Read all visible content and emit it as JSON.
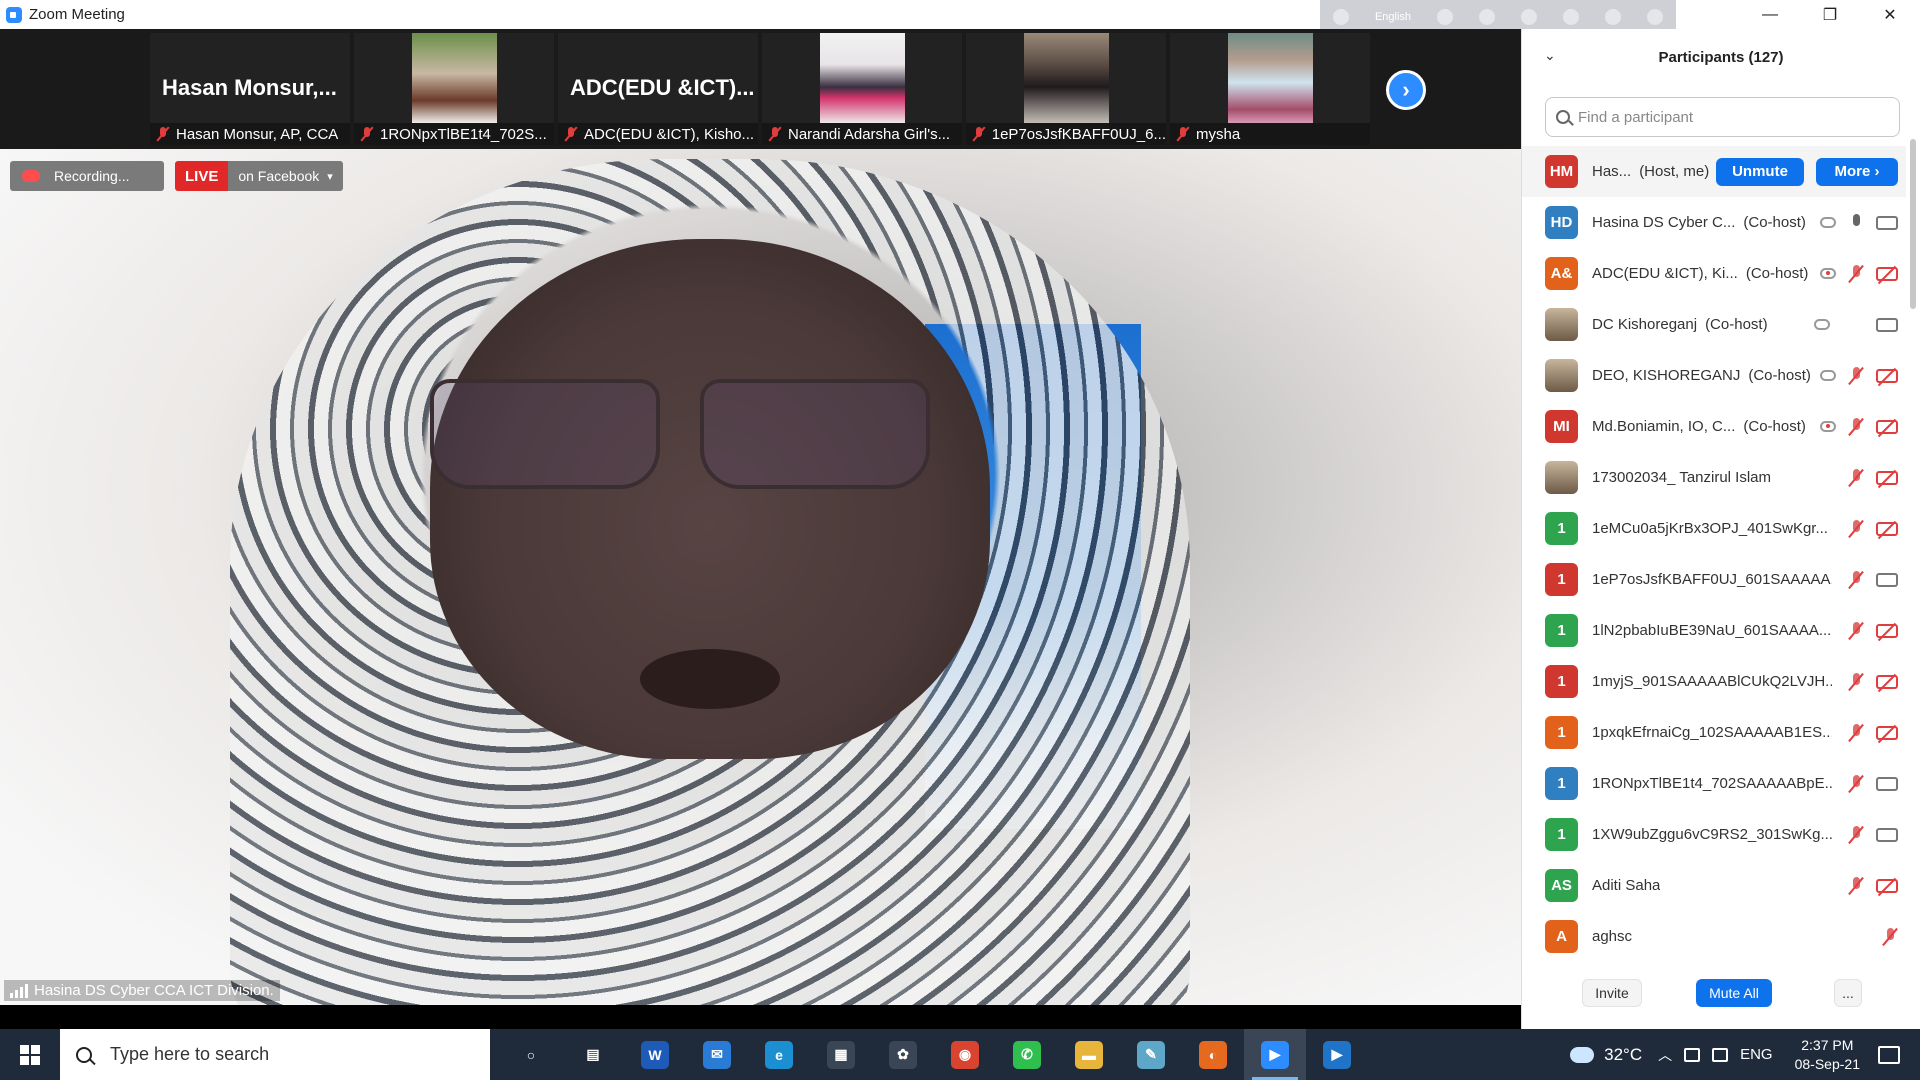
{
  "window": {
    "title": "Zoom Meeting",
    "minimize": "—",
    "maximize": "❐",
    "close": "✕"
  },
  "float_toolbar": {
    "language": "English"
  },
  "strip": {
    "thumbs": [
      {
        "big_name": "Hasan  Monsur,...",
        "caption": "Hasan Monsur, AP, CCA"
      },
      {
        "big_name": "",
        "caption": "1RONpxTlBE1t4_702S..."
      },
      {
        "big_name": "ADC(EDU  &ICT)...",
        "caption": "ADC(EDU &ICT), Kisho..."
      },
      {
        "big_name": "",
        "caption": "Narandi Adarsha Girl's..."
      },
      {
        "big_name": "",
        "caption": "1eP7osJsfKBAFF0UJ_6..."
      },
      {
        "big_name": "",
        "caption": "mysha"
      }
    ],
    "next_icon": "›"
  },
  "main": {
    "recording_label": "Recording...",
    "live_label": "LIVE",
    "live_target": "on Facebook",
    "speaker_name": "Hasina DS Cyber CCA ICT Division."
  },
  "panel": {
    "title": "Participants (127)",
    "collapse_icon": "⌄",
    "search_placeholder": "Find a participant",
    "host": {
      "avatar": "HM",
      "name": "Has...",
      "role": "(Host, me)",
      "unmute": "Unmute",
      "more": "More ›"
    },
    "participants": [
      {
        "avatar": "HD",
        "color": "#2f7fc1",
        "name": "Hasina DS Cyber C...",
        "role": "(Co-host)",
        "rec": "gray",
        "mic": "on",
        "cam": "on"
      },
      {
        "avatar": "A&",
        "color": "#e2611b",
        "name": "ADC(EDU &ICT), Ki...",
        "role": "(Co-host)",
        "rec": "red",
        "mic": "off",
        "cam": "off"
      },
      {
        "avatar": "",
        "color": "photo",
        "name": "DC Kishoreganj",
        "role": "(Co-host)",
        "rec": "gray",
        "mic": "none",
        "cam": "on"
      },
      {
        "avatar": "",
        "color": "photo",
        "name": "DEO, KISHOREGANJ",
        "role": "(Co-host)",
        "rec": "gray",
        "mic": "off",
        "cam": "off"
      },
      {
        "avatar": "MI",
        "color": "#d0372f",
        "name": "Md.Boniamin, IO, C...",
        "role": "(Co-host)",
        "rec": "red",
        "mic": "off",
        "cam": "off"
      },
      {
        "avatar": "",
        "color": "photo",
        "name": "173002034_ Tanzirul Islam",
        "role": "",
        "rec": "none",
        "mic": "off",
        "cam": "off"
      },
      {
        "avatar": "1",
        "color": "#2ea44f",
        "name": "1eMCu0a5jKrBx3OPJ_401SwKgr...",
        "role": "",
        "rec": "none",
        "mic": "off",
        "cam": "off"
      },
      {
        "avatar": "1",
        "color": "#d0372f",
        "name": "1eP7osJsfKBAFF0UJ_601SAAAAA...",
        "role": "",
        "rec": "none",
        "mic": "off",
        "cam": "on"
      },
      {
        "avatar": "1",
        "color": "#2ea44f",
        "name": "1lN2pbabIuBE39NaU_601SAAAA...",
        "role": "",
        "rec": "none",
        "mic": "off",
        "cam": "off"
      },
      {
        "avatar": "1",
        "color": "#d0372f",
        "name": "1myjS_901SAAAAABlCUkQ2LVJH...",
        "role": "",
        "rec": "none",
        "mic": "off",
        "cam": "off"
      },
      {
        "avatar": "1",
        "color": "#e2611b",
        "name": "1pxqkEfrnaiCg_102SAAAAAB1ES...",
        "role": "",
        "rec": "none",
        "mic": "off",
        "cam": "off"
      },
      {
        "avatar": "1",
        "color": "#2f7fc1",
        "name": "1RONpxTlBE1t4_702SAAAAABpE...",
        "role": "",
        "rec": "none",
        "mic": "off",
        "cam": "on"
      },
      {
        "avatar": "1",
        "color": "#2ea44f",
        "name": "1XW9ubZggu6vC9RS2_301SwKg...",
        "role": "",
        "rec": "none",
        "mic": "off",
        "cam": "on"
      },
      {
        "avatar": "AS",
        "color": "#2ea44f",
        "name": "Aditi Saha",
        "role": "",
        "rec": "none",
        "mic": "off",
        "cam": "off"
      },
      {
        "avatar": "A",
        "color": "#e2611b",
        "name": "aghsc",
        "role": "",
        "rec": "none",
        "mic": "none",
        "cam": "offonly"
      }
    ],
    "footer": {
      "invite": "Invite",
      "mute_all": "Mute All",
      "more": "..."
    }
  },
  "taskbar": {
    "search_placeholder": "Type here to search",
    "apps": [
      {
        "name": "cortana-icon",
        "glyph": "○",
        "bg": "transparent"
      },
      {
        "name": "task-view-icon",
        "glyph": "▤",
        "bg": "transparent"
      },
      {
        "name": "word-icon",
        "glyph": "W",
        "bg": "#1e5bb8"
      },
      {
        "name": "mail-icon",
        "glyph": "✉",
        "bg": "#2a7bd6"
      },
      {
        "name": "edge-icon",
        "glyph": "e",
        "bg": "#1b8fd1"
      },
      {
        "name": "store-icon",
        "glyph": "▦",
        "bg": "#3a4656"
      },
      {
        "name": "paint-icon",
        "glyph": "✿",
        "bg": "#3a4656"
      },
      {
        "name": "chrome-icon",
        "glyph": "◉",
        "bg": "#d8442f"
      },
      {
        "name": "whatsapp-icon",
        "glyph": "✆",
        "bg": "#2fbf4f"
      },
      {
        "name": "file-explorer-icon",
        "glyph": "▬",
        "bg": "#e8b53c"
      },
      {
        "name": "pen-icon",
        "glyph": "✎",
        "bg": "#5fa7c9"
      },
      {
        "name": "firefox-icon",
        "glyph": "◐",
        "bg": "#e56a1f"
      },
      {
        "name": "zoom-icon",
        "glyph": "▶",
        "bg": "#2d8cff"
      },
      {
        "name": "video-editor-icon",
        "glyph": "▶",
        "bg": "#1f74c7"
      }
    ],
    "active_app": 12,
    "temperature": "32°C",
    "language": "ENG",
    "time": "2:37 PM",
    "date": "08-Sep-21"
  }
}
